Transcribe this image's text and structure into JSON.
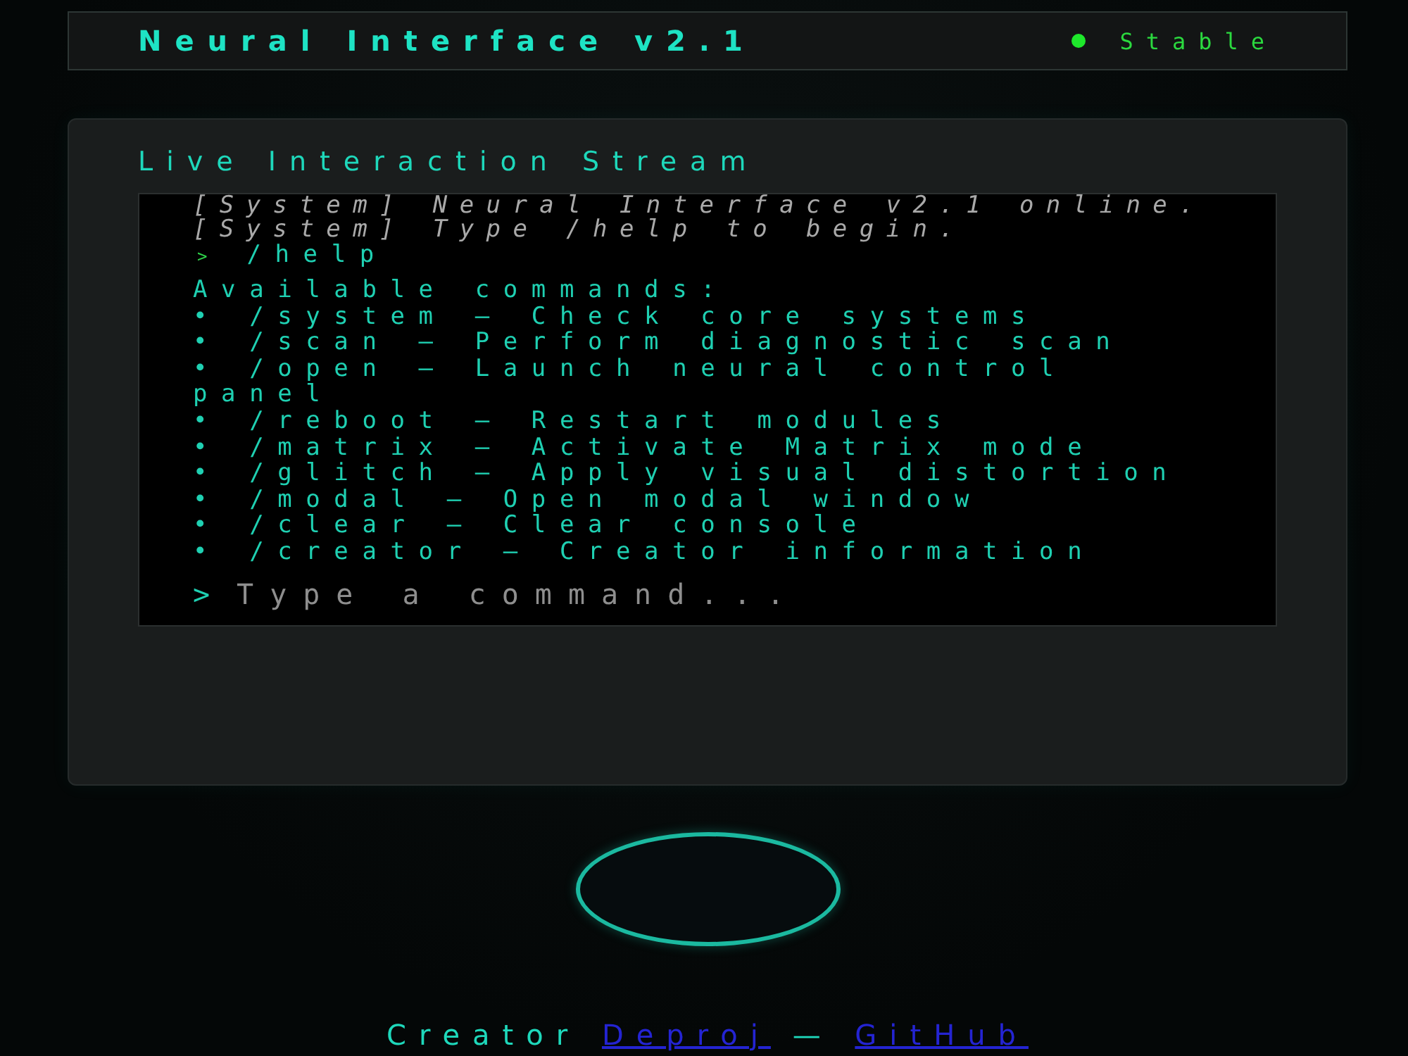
{
  "header": {
    "title": "Neural Interface v2.1",
    "status": {
      "label": "Stable",
      "online": true
    }
  },
  "stream": {
    "title": "Live Interaction Stream",
    "lines": [
      {
        "kind": "system",
        "text": "[System] Neural Interface v2.1 online."
      },
      {
        "kind": "system",
        "text": "[System] Type /help to begin."
      },
      {
        "kind": "command",
        "prompt": ">",
        "text": "/help"
      },
      {
        "kind": "output",
        "text": "Available commands:"
      },
      {
        "kind": "output",
        "text": "• /system — Check core systems"
      },
      {
        "kind": "output",
        "text": "• /scan — Perform diagnostic scan"
      },
      {
        "kind": "output",
        "text": "• /open — Launch neural control panel"
      },
      {
        "kind": "output",
        "text": "• /reboot — Restart modules"
      },
      {
        "kind": "output",
        "text": "• /matrix — Activate Matrix mode"
      },
      {
        "kind": "output",
        "text": "• /glitch — Apply visual distortion"
      },
      {
        "kind": "output",
        "text": "• /modal — Open modal window"
      },
      {
        "kind": "output",
        "text": "• /clear — Clear console"
      },
      {
        "kind": "output",
        "text": "• /creator — Creator information"
      }
    ],
    "input": {
      "prompt": ">",
      "placeholder": "Type a command..."
    }
  },
  "footer": {
    "parts": [
      {
        "kind": "text",
        "text": "Creator"
      },
      {
        "kind": "link",
        "text": "Deproj"
      },
      {
        "kind": "text",
        "text": "—"
      },
      {
        "kind": "link",
        "text": "GitHub"
      }
    ]
  }
}
